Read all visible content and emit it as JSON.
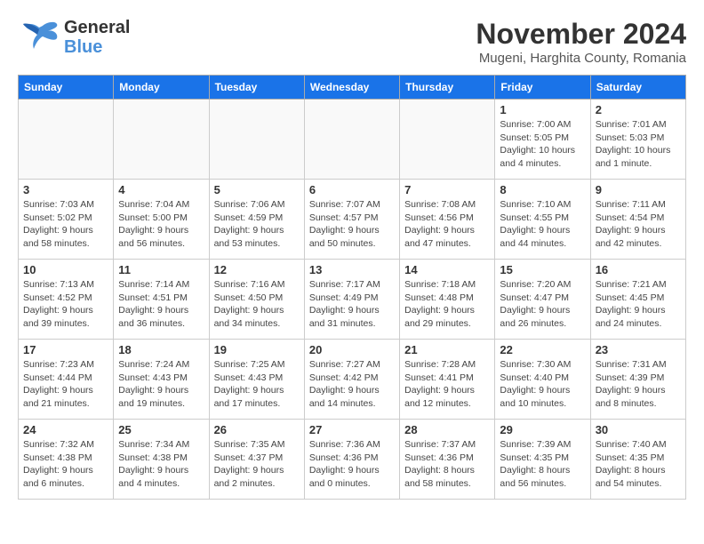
{
  "header": {
    "logo": {
      "line1": "General",
      "line2": "Blue"
    },
    "title": "November 2024",
    "location": "Mugeni, Harghita County, Romania"
  },
  "weekdays": [
    "Sunday",
    "Monday",
    "Tuesday",
    "Wednesday",
    "Thursday",
    "Friday",
    "Saturday"
  ],
  "weeks": [
    [
      {
        "day": "",
        "info": ""
      },
      {
        "day": "",
        "info": ""
      },
      {
        "day": "",
        "info": ""
      },
      {
        "day": "",
        "info": ""
      },
      {
        "day": "",
        "info": ""
      },
      {
        "day": "1",
        "info": "Sunrise: 7:00 AM\nSunset: 5:05 PM\nDaylight: 10 hours and 4 minutes."
      },
      {
        "day": "2",
        "info": "Sunrise: 7:01 AM\nSunset: 5:03 PM\nDaylight: 10 hours and 1 minute."
      }
    ],
    [
      {
        "day": "3",
        "info": "Sunrise: 7:03 AM\nSunset: 5:02 PM\nDaylight: 9 hours and 58 minutes."
      },
      {
        "day": "4",
        "info": "Sunrise: 7:04 AM\nSunset: 5:00 PM\nDaylight: 9 hours and 56 minutes."
      },
      {
        "day": "5",
        "info": "Sunrise: 7:06 AM\nSunset: 4:59 PM\nDaylight: 9 hours and 53 minutes."
      },
      {
        "day": "6",
        "info": "Sunrise: 7:07 AM\nSunset: 4:57 PM\nDaylight: 9 hours and 50 minutes."
      },
      {
        "day": "7",
        "info": "Sunrise: 7:08 AM\nSunset: 4:56 PM\nDaylight: 9 hours and 47 minutes."
      },
      {
        "day": "8",
        "info": "Sunrise: 7:10 AM\nSunset: 4:55 PM\nDaylight: 9 hours and 44 minutes."
      },
      {
        "day": "9",
        "info": "Sunrise: 7:11 AM\nSunset: 4:54 PM\nDaylight: 9 hours and 42 minutes."
      }
    ],
    [
      {
        "day": "10",
        "info": "Sunrise: 7:13 AM\nSunset: 4:52 PM\nDaylight: 9 hours and 39 minutes."
      },
      {
        "day": "11",
        "info": "Sunrise: 7:14 AM\nSunset: 4:51 PM\nDaylight: 9 hours and 36 minutes."
      },
      {
        "day": "12",
        "info": "Sunrise: 7:16 AM\nSunset: 4:50 PM\nDaylight: 9 hours and 34 minutes."
      },
      {
        "day": "13",
        "info": "Sunrise: 7:17 AM\nSunset: 4:49 PM\nDaylight: 9 hours and 31 minutes."
      },
      {
        "day": "14",
        "info": "Sunrise: 7:18 AM\nSunset: 4:48 PM\nDaylight: 9 hours and 29 minutes."
      },
      {
        "day": "15",
        "info": "Sunrise: 7:20 AM\nSunset: 4:47 PM\nDaylight: 9 hours and 26 minutes."
      },
      {
        "day": "16",
        "info": "Sunrise: 7:21 AM\nSunset: 4:45 PM\nDaylight: 9 hours and 24 minutes."
      }
    ],
    [
      {
        "day": "17",
        "info": "Sunrise: 7:23 AM\nSunset: 4:44 PM\nDaylight: 9 hours and 21 minutes."
      },
      {
        "day": "18",
        "info": "Sunrise: 7:24 AM\nSunset: 4:43 PM\nDaylight: 9 hours and 19 minutes."
      },
      {
        "day": "19",
        "info": "Sunrise: 7:25 AM\nSunset: 4:43 PM\nDaylight: 9 hours and 17 minutes."
      },
      {
        "day": "20",
        "info": "Sunrise: 7:27 AM\nSunset: 4:42 PM\nDaylight: 9 hours and 14 minutes."
      },
      {
        "day": "21",
        "info": "Sunrise: 7:28 AM\nSunset: 4:41 PM\nDaylight: 9 hours and 12 minutes."
      },
      {
        "day": "22",
        "info": "Sunrise: 7:30 AM\nSunset: 4:40 PM\nDaylight: 9 hours and 10 minutes."
      },
      {
        "day": "23",
        "info": "Sunrise: 7:31 AM\nSunset: 4:39 PM\nDaylight: 9 hours and 8 minutes."
      }
    ],
    [
      {
        "day": "24",
        "info": "Sunrise: 7:32 AM\nSunset: 4:38 PM\nDaylight: 9 hours and 6 minutes."
      },
      {
        "day": "25",
        "info": "Sunrise: 7:34 AM\nSunset: 4:38 PM\nDaylight: 9 hours and 4 minutes."
      },
      {
        "day": "26",
        "info": "Sunrise: 7:35 AM\nSunset: 4:37 PM\nDaylight: 9 hours and 2 minutes."
      },
      {
        "day": "27",
        "info": "Sunrise: 7:36 AM\nSunset: 4:36 PM\nDaylight: 9 hours and 0 minutes."
      },
      {
        "day": "28",
        "info": "Sunrise: 7:37 AM\nSunset: 4:36 PM\nDaylight: 8 hours and 58 minutes."
      },
      {
        "day": "29",
        "info": "Sunrise: 7:39 AM\nSunset: 4:35 PM\nDaylight: 8 hours and 56 minutes."
      },
      {
        "day": "30",
        "info": "Sunrise: 7:40 AM\nSunset: 4:35 PM\nDaylight: 8 hours and 54 minutes."
      }
    ]
  ]
}
